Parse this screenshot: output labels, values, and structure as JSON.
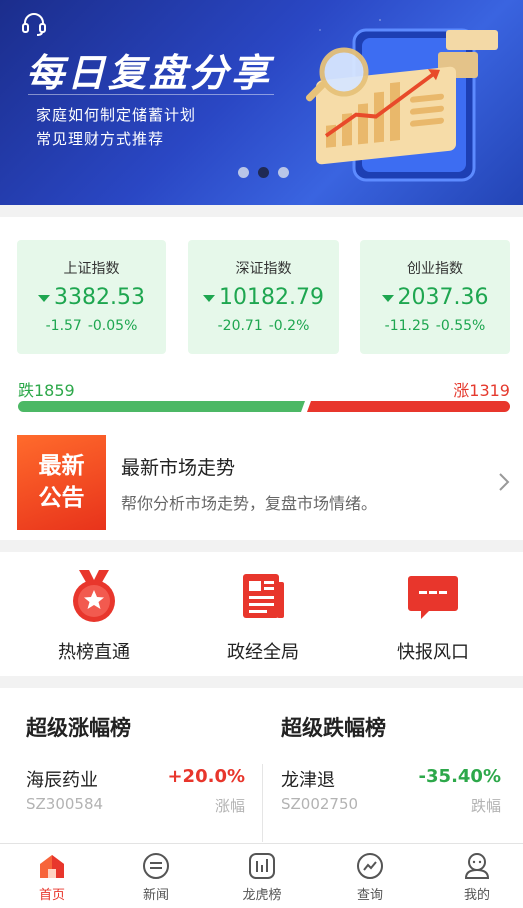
{
  "banner": {
    "title": "每日复盘分享",
    "line1": "家庭如何制定储蓄计划",
    "line2": "常见理财方式推荐",
    "active_dot": 2,
    "dot_count": 3
  },
  "indices": [
    {
      "name": "上证指数",
      "price": "3382.53",
      "change": "-1.57",
      "percent": "-0.05%"
    },
    {
      "name": "深证指数",
      "price": "10182.79",
      "change": "-20.71",
      "percent": "-0.2%"
    },
    {
      "name": "创业指数",
      "price": "2037.36",
      "change": "-11.25",
      "percent": "-0.55%"
    }
  ],
  "breadth": {
    "fall_label": "跌1859",
    "rise_label": "涨1319",
    "fall_count": 1859,
    "rise_count": 1319
  },
  "notice": {
    "badge_line1": "最新",
    "badge_line2": "公告",
    "title": "最新市场走势",
    "desc": "帮你分析市场走势，复盘市场情绪。"
  },
  "quick_links": [
    {
      "label": "热榜直通",
      "icon": "medal-icon"
    },
    {
      "label": "政经全局",
      "icon": "newspaper-icon"
    },
    {
      "label": "快报风口",
      "icon": "message-icon"
    }
  ],
  "rank": {
    "up_title": "超级涨幅榜",
    "down_title": "超级跌幅榜",
    "up": {
      "name": "海辰药业",
      "code": "SZ300584",
      "value": "+20.0%",
      "tag": "涨幅"
    },
    "down": {
      "name": "龙津退",
      "code": "SZ002750",
      "value": "-35.40%",
      "tag": "跌幅"
    }
  },
  "nav": [
    {
      "label": "首页",
      "icon": "home-icon",
      "active": true
    },
    {
      "label": "新闻",
      "icon": "news-icon",
      "active": false
    },
    {
      "label": "龙虎榜",
      "icon": "ranking-icon",
      "active": false
    },
    {
      "label": "查询",
      "icon": "query-icon",
      "active": false
    },
    {
      "label": "我的",
      "icon": "profile-icon",
      "active": false
    }
  ],
  "colors": {
    "up": "#e8362c",
    "down": "#1ea650",
    "accent": "#e8362c"
  }
}
